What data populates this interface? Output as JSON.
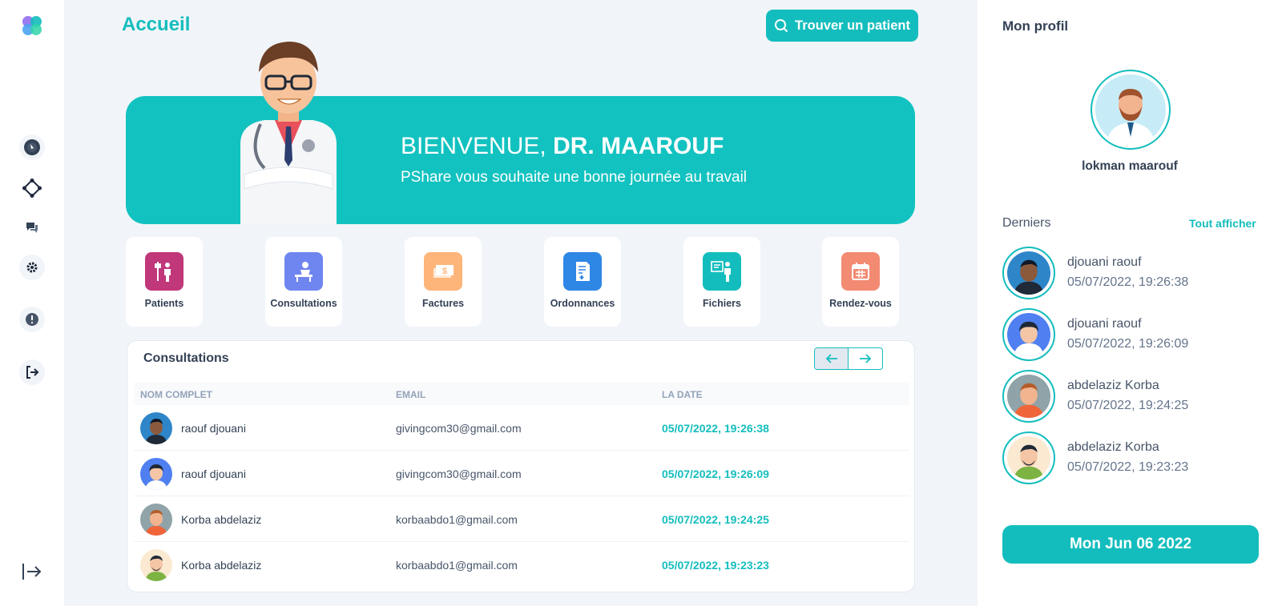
{
  "header": {
    "title": "Accueil",
    "find_patient": "Trouver un patient"
  },
  "banner": {
    "welcome_prefix": "BIENVENUE,",
    "doctor_name": "DR. MAAROUF",
    "subtitle": "PShare vous souhaite une bonne journée au travail"
  },
  "shortcuts": [
    {
      "label": "Patients",
      "icon": "patient-iv-icon",
      "color": "#c0377a"
    },
    {
      "label": "Consultations",
      "icon": "consultation-icon",
      "color": "#6f86f0"
    },
    {
      "label": "Factures",
      "icon": "invoice-icon",
      "color": "#fdb57a"
    },
    {
      "label": "Ordonnances",
      "icon": "prescription-icon",
      "color": "#2e86e5"
    },
    {
      "label": "Fichiers",
      "icon": "files-icon",
      "color": "#14bdbd"
    },
    {
      "label": "Rendez-vous",
      "icon": "calendar-icon",
      "color": "#f28b72"
    }
  ],
  "consultations": {
    "title": "Consultations",
    "columns": [
      "NOM COMPLET",
      "EMAIL",
      "LA DATE"
    ],
    "rows": [
      {
        "name": "raouf djouani",
        "email": "givingcom30@gmail.com",
        "date": "05/07/2022, 19:26:38"
      },
      {
        "name": "raouf djouani",
        "email": "givingcom30@gmail.com",
        "date": "05/07/2022, 19:26:09"
      },
      {
        "name": "Korba abdelaziz",
        "email": "korbaabdo1@gmail.com",
        "date": "05/07/2022, 19:24:25"
      },
      {
        "name": "Korba abdelaziz",
        "email": "korbaabdo1@gmail.com",
        "date": "05/07/2022, 19:23:23"
      }
    ]
  },
  "profile": {
    "heading": "Mon profil",
    "name": "lokman maarouf"
  },
  "recent": {
    "heading": "Derniers",
    "see_all": "Tout afficher",
    "items": [
      {
        "name": "djouani raouf",
        "date": "05/07/2022, 19:26:38"
      },
      {
        "name": "djouani raouf",
        "date": "05/07/2022, 19:26:09"
      },
      {
        "name": "abdelaziz Korba",
        "date": "05/07/2022, 19:24:25"
      },
      {
        "name": "abdelaziz Korba",
        "date": "05/07/2022, 19:23:23"
      }
    ]
  },
  "date_button": "Mon Jun 06 2022",
  "colors": {
    "accent": "#14bdbd",
    "background": "#f1f5f9",
    "text": "#334155"
  }
}
